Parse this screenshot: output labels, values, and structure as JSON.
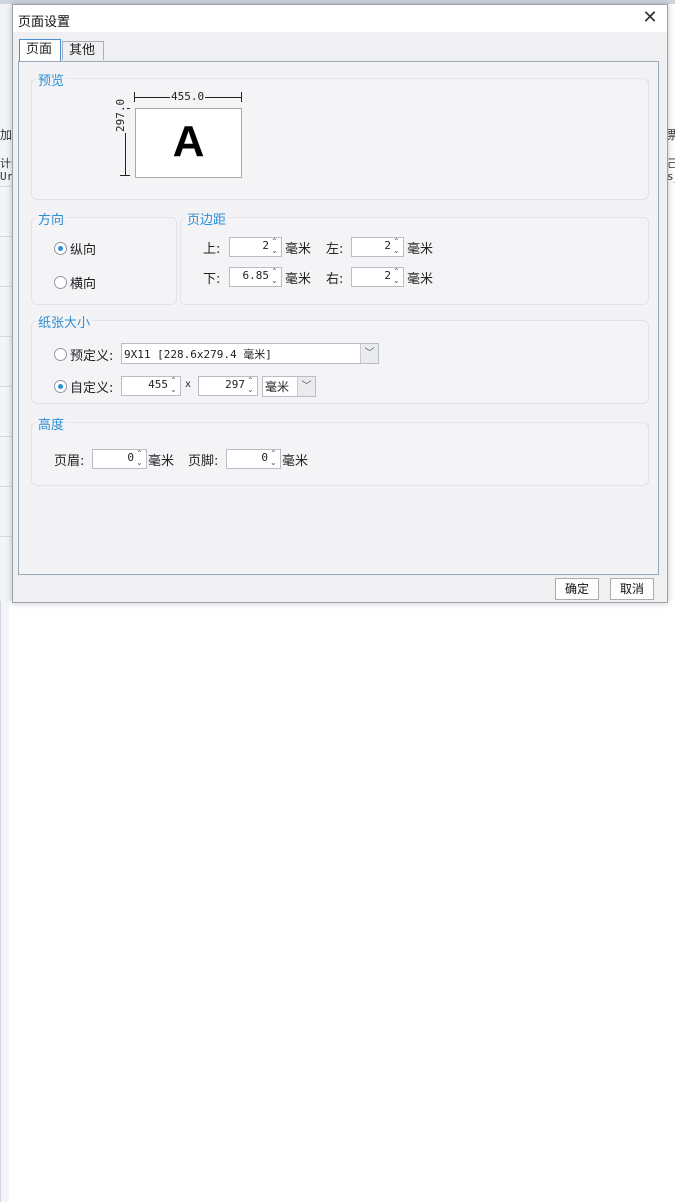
{
  "dialog": {
    "title": "页面设置",
    "close_glyph": "✕"
  },
  "tabs": [
    {
      "label": "页面",
      "active": true
    },
    {
      "label": "其他",
      "active": false
    }
  ],
  "background_fragments": {
    "left_1": "加",
    "left_2": "计分",
    "left_3": "Ur",
    "right_1": "票",
    "right_2": "己",
    "right_3": "s_"
  },
  "preview": {
    "title": "预览",
    "letter": "A",
    "width_label": "455.0",
    "height_label": "297.0"
  },
  "orientation": {
    "title": "方向",
    "options": [
      {
        "label": "纵向",
        "checked": true
      },
      {
        "label": "横向",
        "checked": false
      }
    ]
  },
  "margins": {
    "title": "页边距",
    "top_label": "上:",
    "top_value": "2",
    "left_label": "左:",
    "left_value": "2",
    "bottom_label": "下:",
    "bottom_value": "6.85",
    "right_label": "右:",
    "right_value": "2",
    "unit": "毫米"
  },
  "paper": {
    "title": "纸张大小",
    "preset_label": "预定义:",
    "preset_checked": false,
    "preset_value": "9X11 [228.6x279.4 毫米]",
    "custom_label": "自定义:",
    "custom_checked": true,
    "custom_width": "455",
    "separator": "x",
    "custom_height": "297",
    "unit_value": "毫米"
  },
  "height": {
    "title": "高度",
    "header_label": "页眉:",
    "header_value": "0",
    "footer_label": "页脚:",
    "footer_value": "0",
    "unit": "毫米"
  },
  "buttons": {
    "ok": "确定",
    "cancel": "取消"
  },
  "icons": {
    "spin_up": "chevron-up-icon",
    "spin_down": "chevron-down-icon",
    "dropdown": "chevron-down-icon",
    "close": "close-icon"
  }
}
